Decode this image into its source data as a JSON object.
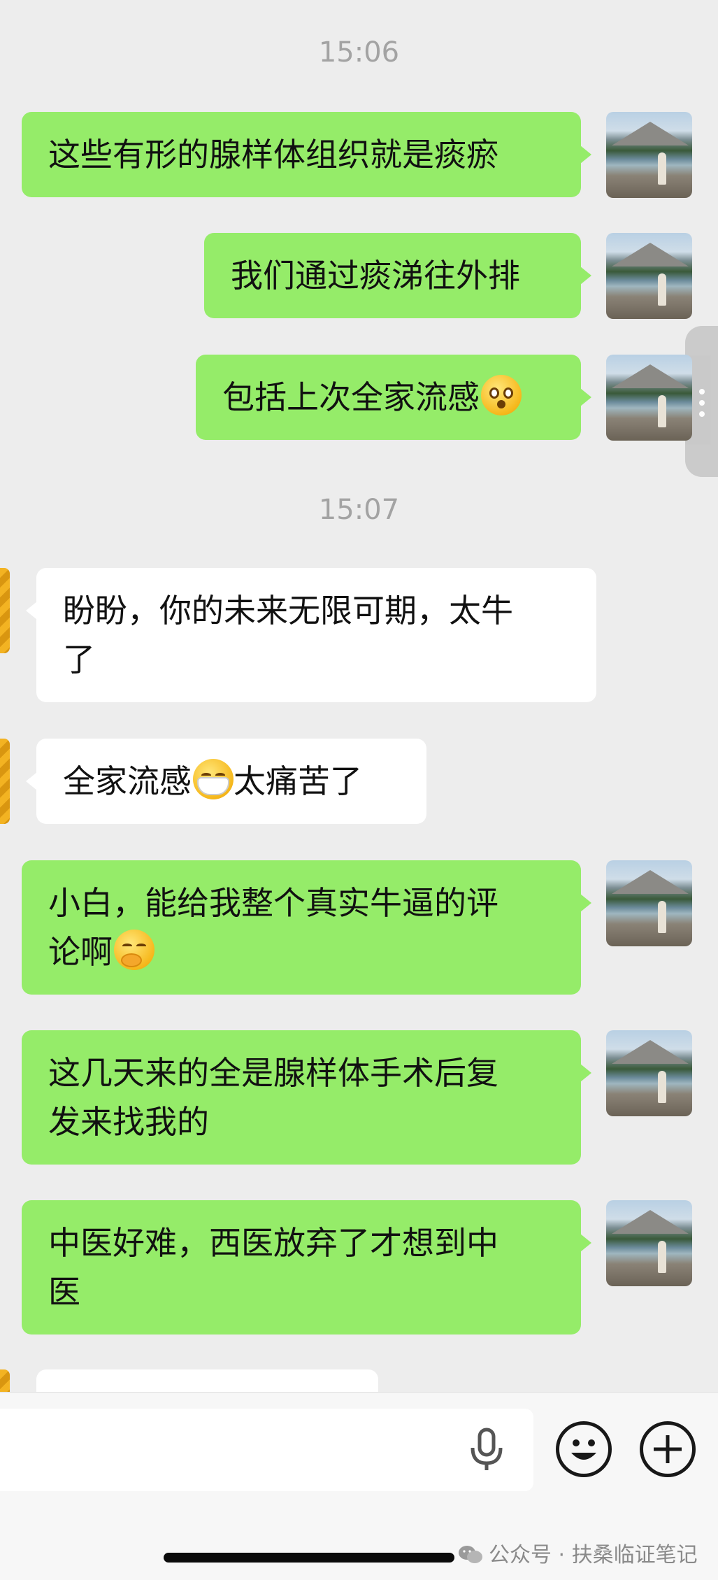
{
  "timestamps": [
    "15:06",
    "15:07"
  ],
  "messages": [
    {
      "sender": "me",
      "text": "这些有形的腺样体组织就是痰瘀"
    },
    {
      "sender": "me",
      "text": "我们通过痰涕往外排"
    },
    {
      "sender": "me",
      "text": "包括上次全家流感",
      "emoji": "flushed-face"
    },
    {
      "sender": "them",
      "line1": "盼盼，你的未来无限可期，太牛",
      "line2": "了"
    },
    {
      "sender": "them",
      "text_before": "全家流感",
      "emoji": "mask-face",
      "text_after": "太痛苦了"
    },
    {
      "sender": "me",
      "line1": "小白，能给我整个真实牛逼的评",
      "line2": "论啊",
      "emoji": "hand-over-mouth-face"
    },
    {
      "sender": "me",
      "line1": "这几天来的全是腺样体手术后复",
      "line2": "发来找我的"
    },
    {
      "sender": "me",
      "line1": "中医好难，西医放弃了才想到中",
      "line2": "医"
    },
    {
      "sender": "them",
      "text": ""
    }
  ],
  "input": {
    "value": "",
    "voice_icon": "microphone-icon",
    "emoji_icon": "smiley-icon",
    "more_icon": "plus-icon"
  },
  "watermark": {
    "text": "公众号 · 扶桑临证笔记",
    "icon": "wechat-icon"
  },
  "colors": {
    "my_bubble": "#95ec69",
    "their_bubble": "#ffffff",
    "background": "#ededed"
  }
}
